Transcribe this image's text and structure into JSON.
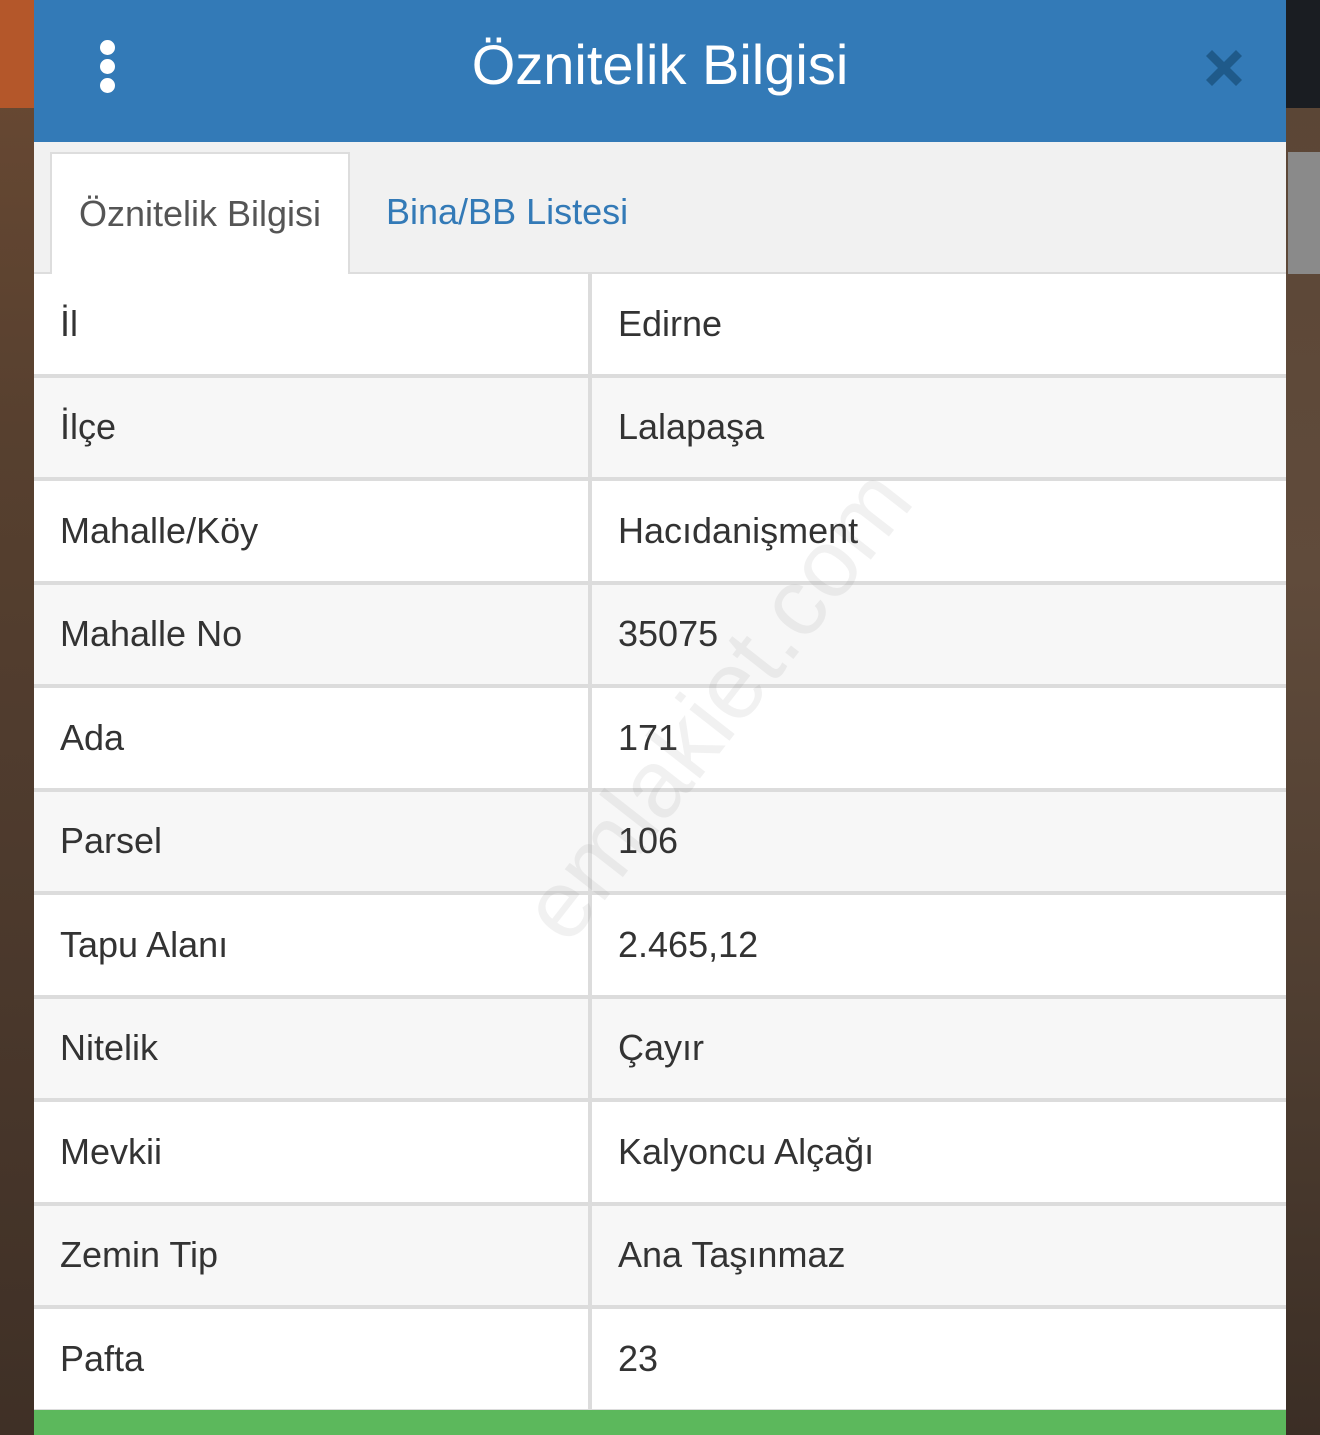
{
  "header": {
    "title": "Öznitelik Bilgisi"
  },
  "tabs": [
    {
      "label": "Öznitelik Bilgisi",
      "active": true
    },
    {
      "label": "Bina/BB Listesi",
      "active": false
    }
  ],
  "rows": [
    {
      "label": "İl",
      "value": "Edirne"
    },
    {
      "label": "İlçe",
      "value": "Lalapaşa"
    },
    {
      "label": "Mahalle/Köy",
      "value": "Hacıdanişment"
    },
    {
      "label": "Mahalle No",
      "value": "35075"
    },
    {
      "label": "Ada",
      "value": "171"
    },
    {
      "label": "Parsel",
      "value": "106"
    },
    {
      "label": "Tapu Alanı",
      "value": "2.465,12"
    },
    {
      "label": "Nitelik",
      "value": "Çayır"
    },
    {
      "label": "Mevkii",
      "value": "Kalyoncu Alçağı"
    },
    {
      "label": "Zemin Tip",
      "value": "Ana Taşınmaz"
    },
    {
      "label": "Pafta",
      "value": "23"
    }
  ],
  "watermark": "emlakiet.com",
  "icons": {
    "menu": "vertical-dots-icon",
    "close": "close-x-icon"
  },
  "colors": {
    "header": "#337ab7",
    "tab_link": "#337ab7",
    "footer": "#5cb85c",
    "close_icon": "#1f5a8a"
  }
}
